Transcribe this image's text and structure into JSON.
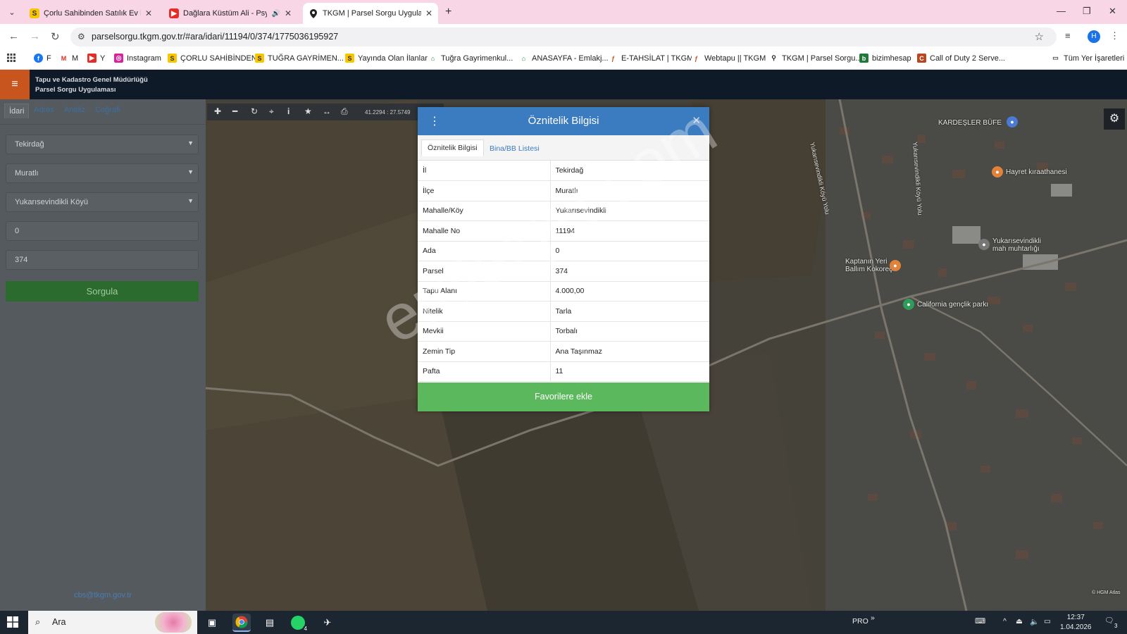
{
  "browser": {
    "tabs": [
      {
        "title": "Çorlu Sahibinden Satılık Ev Fiya",
        "favicon": "S"
      },
      {
        "title": "Dağlara Küstüm Ali - Psych",
        "favicon": "▶"
      },
      {
        "title": "TKGM | Parsel Sorgu Uygulama",
        "favicon": "pin"
      }
    ],
    "url": "parselsorgu.tkgm.gov.tr/#ara/idari/11194/0/374/1775036195927",
    "avatar_letter": "H",
    "bookmarks": [
      {
        "label": "F"
      },
      {
        "label": "M"
      },
      {
        "label": "Y"
      },
      {
        "label": "Instagram"
      },
      {
        "label": "ÇORLU SAHİBİNDEN"
      },
      {
        "label": "TUĞRA GAYRİMEN..."
      },
      {
        "label": "Yayında Olan İlanlar"
      },
      {
        "label": "Tuğra Gayrimenkul..."
      },
      {
        "label": "ANASAYFA - Emlakj..."
      },
      {
        "label": "E-TAHSİLAT | TKGM"
      },
      {
        "label": "Webtapu || TKGM"
      },
      {
        "label": "TKGM | Parsel Sorgu..."
      },
      {
        "label": "bizimhesap"
      },
      {
        "label": "Call of Duty 2 Serve..."
      },
      {
        "label": "Tüm Yer İşaretleri"
      }
    ]
  },
  "app": {
    "org_line1": "Tapu ve Kadastro Genel Müdürlüğü",
    "org_line2": "Parsel Sorgu Uygulaması",
    "left_tabs": [
      "İdari",
      "Adres",
      "Analiz",
      "Coğrafi"
    ],
    "fields": {
      "il": "Tekirdağ",
      "ilce": "Muratlı",
      "mahalle": "Yukarısevindikli Köyü",
      "ada": "0",
      "parsel": "374"
    },
    "search_button": "Sorgula",
    "email": "cbs@tkgm.gov.tr",
    "coords": "41.2294 : 27.5749"
  },
  "map_labels": {
    "kardesler": "KARDEŞLER BÜFE",
    "hayret": "Hayret kıraathanesi",
    "muhtarlik1": "Yukarısevindikli",
    "muhtarlik2": "mah muhtarlığı",
    "kaptanin1": "Kaptanın Yeri",
    "kaptanin2": "Ballım Kokoreç",
    "california": "California gençlik parkı",
    "road1": "Yukarısevindikli Köyü Yolu",
    "road2": "Yukarısevindikli Köyü Yolu",
    "attribution": "© HGM Atlas"
  },
  "modal": {
    "title": "Öznitelik Bilgisi",
    "tab_active": "Öznitelik Bilgisi",
    "tab_other": "Bina/BB Listesi",
    "rows": [
      {
        "k": "İl",
        "v": "Tekirdağ"
      },
      {
        "k": "İlçe",
        "v": "Muratlı"
      },
      {
        "k": "Mahalle/Köy",
        "v": "Yukarısevindikli"
      },
      {
        "k": "Mahalle No",
        "v": "11194"
      },
      {
        "k": "Ada",
        "v": "0"
      },
      {
        "k": "Parsel",
        "v": "374"
      },
      {
        "k": "Tapu Alanı",
        "v": "4.000,00"
      },
      {
        "k": "Nitelik",
        "v": "Tarla"
      },
      {
        "k": "Mevkii",
        "v": "Torbalı"
      },
      {
        "k": "Zemin Tip",
        "v": "Ana Taşınmaz"
      },
      {
        "k": "Pafta",
        "v": "11"
      }
    ],
    "favorite_button": "Favorilere ekle"
  },
  "watermark": "emlakjet.com",
  "taskbar": {
    "search_placeholder": "Ara",
    "tray_label": "PRO",
    "time": "12:37",
    "date": "1.04.2026",
    "notif_count": "3",
    "whatsapp_badge": "4"
  }
}
